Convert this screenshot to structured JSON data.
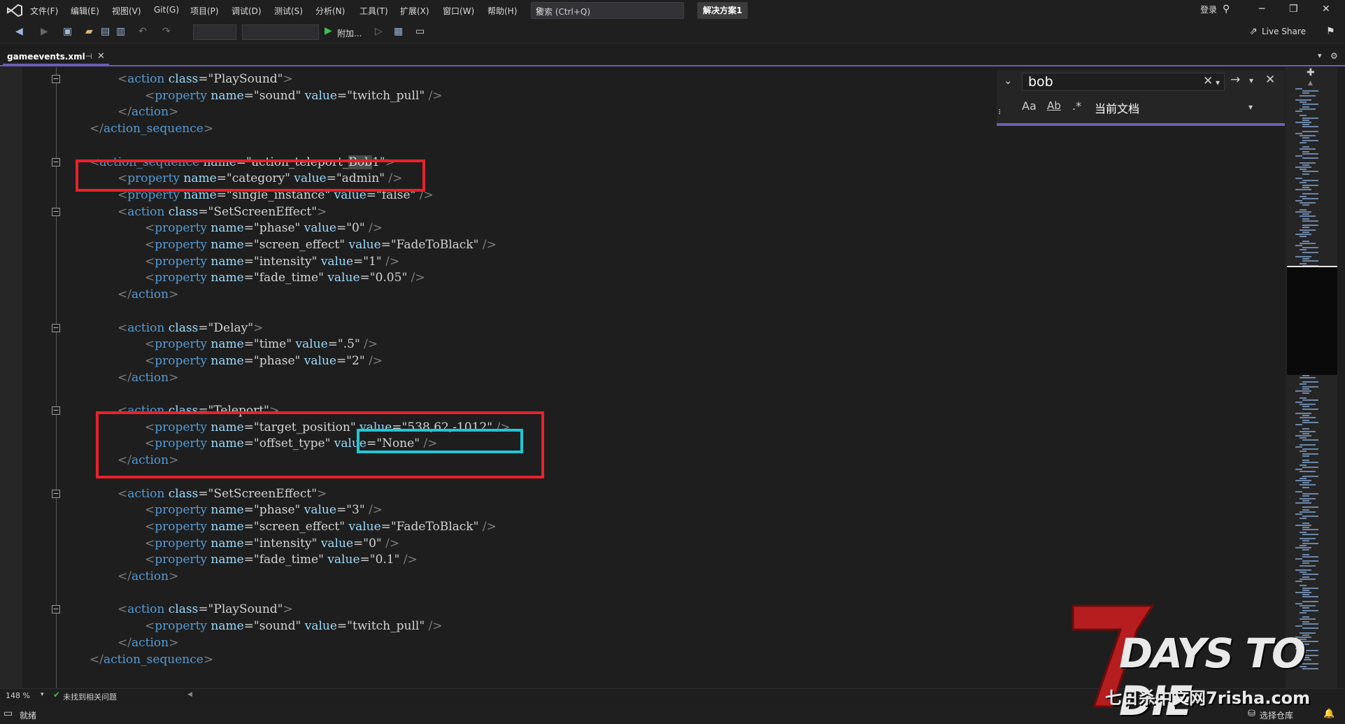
{
  "menubar": {
    "items": [
      "文件(F)",
      "编辑(E)",
      "视图(V)",
      "Git(G)",
      "项目(P)",
      "调试(D)",
      "测试(S)",
      "分析(N)",
      "工具(T)",
      "扩展(X)",
      "窗口(W)",
      "帮助(H)"
    ],
    "search_placeholder": "搜索 (Ctrl+Q)",
    "solution": "解决方案1",
    "login": "登录"
  },
  "toolbar": {
    "attach_label": "附加...",
    "live_share": "Live Share"
  },
  "tab": {
    "filename": "gameevents.xml"
  },
  "find": {
    "query": "bob",
    "case_label": "Aa",
    "word_label": "Ab",
    "scope": "当前文档"
  },
  "editor": {
    "lines": [
      {
        "indent": 2,
        "parts": [
          [
            "t",
            "<"
          ],
          [
            "k",
            "action"
          ],
          [
            "v",
            " "
          ],
          [
            "a",
            "class"
          ],
          [
            "q",
            "=\""
          ],
          [
            "v",
            "PlaySound"
          ],
          [
            "q",
            "\""
          ],
          [
            "t",
            ">"
          ]
        ]
      },
      {
        "indent": 3,
        "parts": [
          [
            "t",
            "<"
          ],
          [
            "k",
            "property"
          ],
          [
            "v",
            " "
          ],
          [
            "a",
            "name"
          ],
          [
            "q",
            "=\""
          ],
          [
            "v",
            "sound"
          ],
          [
            "q",
            "\" "
          ],
          [
            "a",
            "value"
          ],
          [
            "q",
            "=\""
          ],
          [
            "v",
            "twitch_pull"
          ],
          [
            "q",
            "\" "
          ],
          [
            "t",
            "/>"
          ]
        ]
      },
      {
        "indent": 2,
        "parts": [
          [
            "t",
            "</"
          ],
          [
            "k",
            "action"
          ],
          [
            "t",
            ">"
          ]
        ]
      },
      {
        "indent": 1,
        "parts": [
          [
            "t",
            "</"
          ],
          [
            "k",
            "action_sequence"
          ],
          [
            "t",
            ">"
          ]
        ]
      },
      {
        "indent": 0,
        "parts": []
      },
      {
        "indent": 1,
        "parts": [
          [
            "t",
            "<"
          ],
          [
            "k",
            "action_sequence"
          ],
          [
            "v",
            " "
          ],
          [
            "a",
            "name"
          ],
          [
            "q",
            "=\""
          ],
          [
            "v",
            "action_teleport_"
          ],
          [
            "h",
            "Bob"
          ],
          [
            "v",
            "1"
          ],
          [
            "q",
            "\""
          ],
          [
            "t",
            ">"
          ]
        ]
      },
      {
        "indent": 2,
        "parts": [
          [
            "t",
            "<"
          ],
          [
            "k",
            "property"
          ],
          [
            "v",
            " "
          ],
          [
            "a",
            "name"
          ],
          [
            "q",
            "=\""
          ],
          [
            "v",
            "category"
          ],
          [
            "q",
            "\" "
          ],
          [
            "a",
            "value"
          ],
          [
            "q",
            "=\""
          ],
          [
            "v",
            "admin"
          ],
          [
            "q",
            "\" "
          ],
          [
            "t",
            "/>"
          ]
        ]
      },
      {
        "indent": 2,
        "parts": [
          [
            "t",
            "<"
          ],
          [
            "k",
            "property"
          ],
          [
            "v",
            " "
          ],
          [
            "a",
            "name"
          ],
          [
            "q",
            "=\""
          ],
          [
            "v",
            "single_instance"
          ],
          [
            "q",
            "\" "
          ],
          [
            "a",
            "value"
          ],
          [
            "q",
            "=\""
          ],
          [
            "v",
            "false"
          ],
          [
            "q",
            "\" "
          ],
          [
            "t",
            "/>"
          ]
        ]
      },
      {
        "indent": 2,
        "parts": [
          [
            "t",
            "<"
          ],
          [
            "k",
            "action"
          ],
          [
            "v",
            " "
          ],
          [
            "a",
            "class"
          ],
          [
            "q",
            "=\""
          ],
          [
            "v",
            "SetScreenEffect"
          ],
          [
            "q",
            "\""
          ],
          [
            "t",
            ">"
          ]
        ]
      },
      {
        "indent": 3,
        "parts": [
          [
            "t",
            "<"
          ],
          [
            "k",
            "property"
          ],
          [
            "v",
            " "
          ],
          [
            "a",
            "name"
          ],
          [
            "q",
            "=\""
          ],
          [
            "v",
            "phase"
          ],
          [
            "q",
            "\" "
          ],
          [
            "a",
            "value"
          ],
          [
            "q",
            "=\""
          ],
          [
            "v",
            "0"
          ],
          [
            "q",
            "\" "
          ],
          [
            "t",
            "/>"
          ]
        ]
      },
      {
        "indent": 3,
        "parts": [
          [
            "t",
            "<"
          ],
          [
            "k",
            "property"
          ],
          [
            "v",
            " "
          ],
          [
            "a",
            "name"
          ],
          [
            "q",
            "=\""
          ],
          [
            "v",
            "screen_effect"
          ],
          [
            "q",
            "\" "
          ],
          [
            "a",
            "value"
          ],
          [
            "q",
            "=\""
          ],
          [
            "v",
            "FadeToBlack"
          ],
          [
            "q",
            "\" "
          ],
          [
            "t",
            "/>"
          ]
        ]
      },
      {
        "indent": 3,
        "parts": [
          [
            "t",
            "<"
          ],
          [
            "k",
            "property"
          ],
          [
            "v",
            " "
          ],
          [
            "a",
            "name"
          ],
          [
            "q",
            "=\""
          ],
          [
            "v",
            "intensity"
          ],
          [
            "q",
            "\" "
          ],
          [
            "a",
            "value"
          ],
          [
            "q",
            "=\""
          ],
          [
            "v",
            "1"
          ],
          [
            "q",
            "\" "
          ],
          [
            "t",
            "/>"
          ]
        ]
      },
      {
        "indent": 3,
        "parts": [
          [
            "t",
            "<"
          ],
          [
            "k",
            "property"
          ],
          [
            "v",
            " "
          ],
          [
            "a",
            "name"
          ],
          [
            "q",
            "=\""
          ],
          [
            "v",
            "fade_time"
          ],
          [
            "q",
            "\" "
          ],
          [
            "a",
            "value"
          ],
          [
            "q",
            "=\""
          ],
          [
            "v",
            "0.05"
          ],
          [
            "q",
            "\" "
          ],
          [
            "t",
            "/>"
          ]
        ]
      },
      {
        "indent": 2,
        "parts": [
          [
            "t",
            "</"
          ],
          [
            "k",
            "action"
          ],
          [
            "t",
            ">"
          ]
        ]
      },
      {
        "indent": 0,
        "parts": []
      },
      {
        "indent": 2,
        "parts": [
          [
            "t",
            "<"
          ],
          [
            "k",
            "action"
          ],
          [
            "v",
            " "
          ],
          [
            "a",
            "class"
          ],
          [
            "q",
            "=\""
          ],
          [
            "v",
            "Delay"
          ],
          [
            "q",
            "\""
          ],
          [
            "t",
            ">"
          ]
        ]
      },
      {
        "indent": 3,
        "parts": [
          [
            "t",
            "<"
          ],
          [
            "k",
            "property"
          ],
          [
            "v",
            " "
          ],
          [
            "a",
            "name"
          ],
          [
            "q",
            "=\""
          ],
          [
            "v",
            "time"
          ],
          [
            "q",
            "\" "
          ],
          [
            "a",
            "value"
          ],
          [
            "q",
            "=\""
          ],
          [
            "v",
            ".5"
          ],
          [
            "q",
            "\" "
          ],
          [
            "t",
            "/>"
          ]
        ]
      },
      {
        "indent": 3,
        "parts": [
          [
            "t",
            "<"
          ],
          [
            "k",
            "property"
          ],
          [
            "v",
            " "
          ],
          [
            "a",
            "name"
          ],
          [
            "q",
            "=\""
          ],
          [
            "v",
            "phase"
          ],
          [
            "q",
            "\" "
          ],
          [
            "a",
            "value"
          ],
          [
            "q",
            "=\""
          ],
          [
            "v",
            "2"
          ],
          [
            "q",
            "\" "
          ],
          [
            "t",
            "/>"
          ]
        ]
      },
      {
        "indent": 2,
        "parts": [
          [
            "t",
            "</"
          ],
          [
            "k",
            "action"
          ],
          [
            "t",
            ">"
          ]
        ]
      },
      {
        "indent": 0,
        "parts": []
      },
      {
        "indent": 2,
        "parts": [
          [
            "t",
            "<"
          ],
          [
            "k",
            "action"
          ],
          [
            "v",
            " "
          ],
          [
            "a",
            "class"
          ],
          [
            "q",
            "=\""
          ],
          [
            "v",
            "Teleport"
          ],
          [
            "q",
            "\""
          ],
          [
            "t",
            ">"
          ]
        ]
      },
      {
        "indent": 3,
        "parts": [
          [
            "t",
            "<"
          ],
          [
            "k",
            "property"
          ],
          [
            "v",
            " "
          ],
          [
            "a",
            "name"
          ],
          [
            "q",
            "=\""
          ],
          [
            "v",
            "target_position"
          ],
          [
            "q",
            "\" "
          ],
          [
            "a",
            "value"
          ],
          [
            "q",
            "=\""
          ],
          [
            "v",
            "538,62,-1012"
          ],
          [
            "q",
            "\" "
          ],
          [
            "t",
            "/>"
          ]
        ]
      },
      {
        "indent": 3,
        "parts": [
          [
            "t",
            "<"
          ],
          [
            "k",
            "property"
          ],
          [
            "v",
            " "
          ],
          [
            "a",
            "name"
          ],
          [
            "q",
            "=\""
          ],
          [
            "v",
            "offset_type"
          ],
          [
            "q",
            "\" "
          ],
          [
            "a",
            "value"
          ],
          [
            "q",
            "=\""
          ],
          [
            "v",
            "None"
          ],
          [
            "q",
            "\" "
          ],
          [
            "t",
            "/>"
          ]
        ]
      },
      {
        "indent": 2,
        "parts": [
          [
            "t",
            "</"
          ],
          [
            "k",
            "action"
          ],
          [
            "t",
            ">"
          ]
        ]
      },
      {
        "indent": 0,
        "parts": []
      },
      {
        "indent": 2,
        "parts": [
          [
            "t",
            "<"
          ],
          [
            "k",
            "action"
          ],
          [
            "v",
            " "
          ],
          [
            "a",
            "class"
          ],
          [
            "q",
            "=\""
          ],
          [
            "v",
            "SetScreenEffect"
          ],
          [
            "q",
            "\""
          ],
          [
            "t",
            ">"
          ]
        ]
      },
      {
        "indent": 3,
        "parts": [
          [
            "t",
            "<"
          ],
          [
            "k",
            "property"
          ],
          [
            "v",
            " "
          ],
          [
            "a",
            "name"
          ],
          [
            "q",
            "=\""
          ],
          [
            "v",
            "phase"
          ],
          [
            "q",
            "\" "
          ],
          [
            "a",
            "value"
          ],
          [
            "q",
            "=\""
          ],
          [
            "v",
            "3"
          ],
          [
            "q",
            "\" "
          ],
          [
            "t",
            "/>"
          ]
        ]
      },
      {
        "indent": 3,
        "parts": [
          [
            "t",
            "<"
          ],
          [
            "k",
            "property"
          ],
          [
            "v",
            " "
          ],
          [
            "a",
            "name"
          ],
          [
            "q",
            "=\""
          ],
          [
            "v",
            "screen_effect"
          ],
          [
            "q",
            "\" "
          ],
          [
            "a",
            "value"
          ],
          [
            "q",
            "=\""
          ],
          [
            "v",
            "FadeToBlack"
          ],
          [
            "q",
            "\" "
          ],
          [
            "t",
            "/>"
          ]
        ]
      },
      {
        "indent": 3,
        "parts": [
          [
            "t",
            "<"
          ],
          [
            "k",
            "property"
          ],
          [
            "v",
            " "
          ],
          [
            "a",
            "name"
          ],
          [
            "q",
            "=\""
          ],
          [
            "v",
            "intensity"
          ],
          [
            "q",
            "\" "
          ],
          [
            "a",
            "value"
          ],
          [
            "q",
            "=\""
          ],
          [
            "v",
            "0"
          ],
          [
            "q",
            "\" "
          ],
          [
            "t",
            "/>"
          ]
        ]
      },
      {
        "indent": 3,
        "parts": [
          [
            "t",
            "<"
          ],
          [
            "k",
            "property"
          ],
          [
            "v",
            " "
          ],
          [
            "a",
            "name"
          ],
          [
            "q",
            "=\""
          ],
          [
            "v",
            "fade_time"
          ],
          [
            "q",
            "\" "
          ],
          [
            "a",
            "value"
          ],
          [
            "q",
            "=\""
          ],
          [
            "v",
            "0.1"
          ],
          [
            "q",
            "\" "
          ],
          [
            "t",
            "/>"
          ]
        ]
      },
      {
        "indent": 2,
        "parts": [
          [
            "t",
            "</"
          ],
          [
            "k",
            "action"
          ],
          [
            "t",
            ">"
          ]
        ]
      },
      {
        "indent": 0,
        "parts": []
      },
      {
        "indent": 2,
        "parts": [
          [
            "t",
            "<"
          ],
          [
            "k",
            "action"
          ],
          [
            "v",
            " "
          ],
          [
            "a",
            "class"
          ],
          [
            "q",
            "=\""
          ],
          [
            "v",
            "PlaySound"
          ],
          [
            "q",
            "\""
          ],
          [
            "t",
            ">"
          ]
        ]
      },
      {
        "indent": 3,
        "parts": [
          [
            "t",
            "<"
          ],
          [
            "k",
            "property"
          ],
          [
            "v",
            " "
          ],
          [
            "a",
            "name"
          ],
          [
            "q",
            "=\""
          ],
          [
            "v",
            "sound"
          ],
          [
            "q",
            "\" "
          ],
          [
            "a",
            "value"
          ],
          [
            "q",
            "=\""
          ],
          [
            "v",
            "twitch_pull"
          ],
          [
            "q",
            "\" "
          ],
          [
            "t",
            "/>"
          ]
        ]
      },
      {
        "indent": 2,
        "parts": [
          [
            "t",
            "</"
          ],
          [
            "k",
            "action"
          ],
          [
            "t",
            ">"
          ]
        ]
      },
      {
        "indent": 1,
        "parts": [
          [
            "t",
            "</"
          ],
          [
            "k",
            "action_sequence"
          ],
          [
            "t",
            ">"
          ]
        ]
      }
    ]
  },
  "status": {
    "zoom": "148 %",
    "issues": "未找到相关问题",
    "ready": "就绪",
    "repo": "选择仓库"
  },
  "watermark": {
    "title": "7 DAYS TO DIE",
    "subtitle": "七日杀中文网7risha.com"
  },
  "colors": {
    "accent": "#6b5fb5",
    "highlight_red": "#e8222b",
    "highlight_cyan": "#21c6d2"
  }
}
